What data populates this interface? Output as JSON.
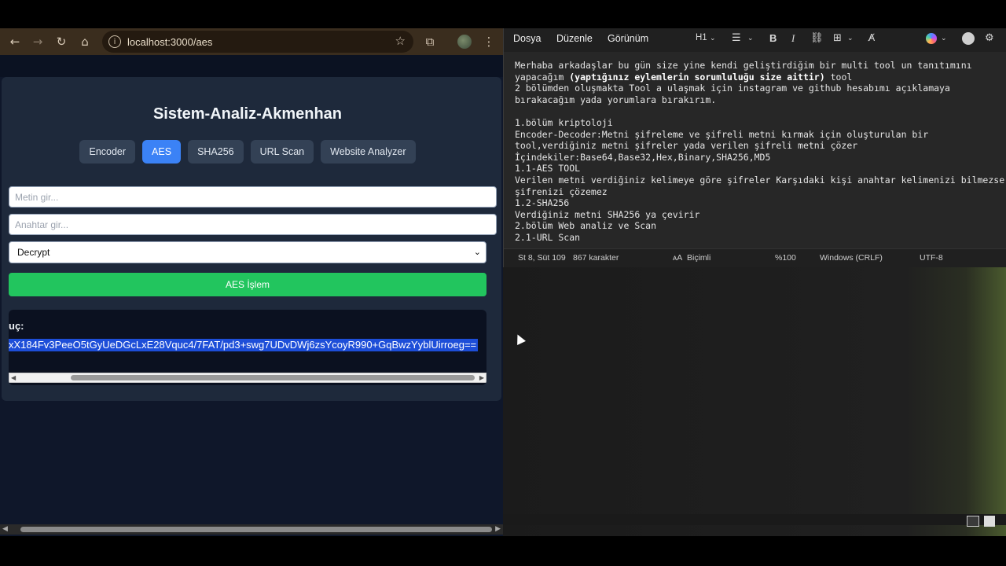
{
  "browser": {
    "url": "localhost:3000/aes",
    "icons": [
      "back-arrow-icon",
      "forward-arrow-icon",
      "reload-icon",
      "home-icon",
      "site-info-icon",
      "star-icon",
      "extensions-icon",
      "profile-avatar",
      "kebab-menu-icon"
    ]
  },
  "app": {
    "title": "Sistem-Analiz-Akmenhan",
    "tabs": [
      {
        "label": "Encoder",
        "active": false
      },
      {
        "label": "AES",
        "active": true
      },
      {
        "label": "SHA256",
        "active": false
      },
      {
        "label": "URL Scan",
        "active": false
      },
      {
        "label": "Website Analyzer",
        "active": false
      }
    ],
    "text_input": {
      "placeholder": "Metin gir..."
    },
    "key_input": {
      "placeholder": "Anahtar gir..."
    },
    "mode_select": {
      "value": "Decrypt"
    },
    "run_button": "AES İşlem",
    "result_label": "uç:",
    "result_value": "xX184Fv3PeeO5tGyUeDGcLxE28Vquc4/7FAT/pd3+swg7UDvDWj6zsYcoyR990+GqBwzYyblUirroeg==",
    "colors": {
      "accent": "#3b82f6",
      "success": "#22c55e",
      "card": "#1e293b",
      "background": "#0f172a"
    }
  },
  "notepad": {
    "menus": [
      "Dosya",
      "Düzenle",
      "Görünüm"
    ],
    "heading_tool": "H1",
    "lines": [
      [
        {
          "t": "Merhaba arkadaşlar bu gün size yine kendi geliştirdiğim bir multi tool un tanıtımını",
          "b": false
        }
      ],
      [
        {
          "t": "yapacağım ",
          "b": false
        },
        {
          "t": "(yaptığınız eylemlerin sorumluluğu size aittir)",
          "b": true
        },
        {
          "t": " tool",
          "b": false
        }
      ],
      [
        {
          "t": "2 bölümden oluşmakta Tool a ulaşmak için instagram ve github hesabımı açıklamaya",
          "b": false
        }
      ],
      [
        {
          "t": "bırakacağım yada yorumlara bırakırım.",
          "b": false
        }
      ],
      [
        {
          "t": "",
          "b": false
        }
      ],
      [
        {
          "t": "1.bölüm kriptoloji",
          "b": false
        }
      ],
      [
        {
          "t": "Encoder-Decoder:Metni şifreleme ve şifreli metni kırmak için oluşturulan bir",
          "b": false
        }
      ],
      [
        {
          "t": "tool,verdiğiniz metni şifreler yada verilen şifreli metni çözer",
          "b": false
        }
      ],
      [
        {
          "t": "İçindekiler:Base64,Base32,Hex,Binary,SHA256,MD5",
          "b": false
        }
      ],
      [
        {
          "t": "1.1-AES TOOL",
          "b": false
        }
      ],
      [
        {
          "t": "Verilen metni verdiğiniz kelimeye göre şifreler Karşıdaki kişi anahtar kelimenizi bilmezse",
          "b": false
        }
      ],
      [
        {
          "t": "şifrenizi çözemez",
          "b": false
        }
      ],
      [
        {
          "t": "1.2-SHA256",
          "b": false
        }
      ],
      [
        {
          "t": "Verdiğiniz metni SHA256 ya çevirir",
          "b": false
        }
      ],
      [
        {
          "t": "2.bölüm Web analiz ve Scan",
          "b": false
        }
      ],
      [
        {
          "t": "2.1-URL Scan",
          "b": false
        }
      ]
    ],
    "status": {
      "position": "St 8, Süt 109",
      "chars": "867 karakter",
      "format": "Biçimli",
      "zoom": "%100",
      "line_endings": "Windows (CRLF)",
      "encoding": "UTF-8"
    }
  }
}
